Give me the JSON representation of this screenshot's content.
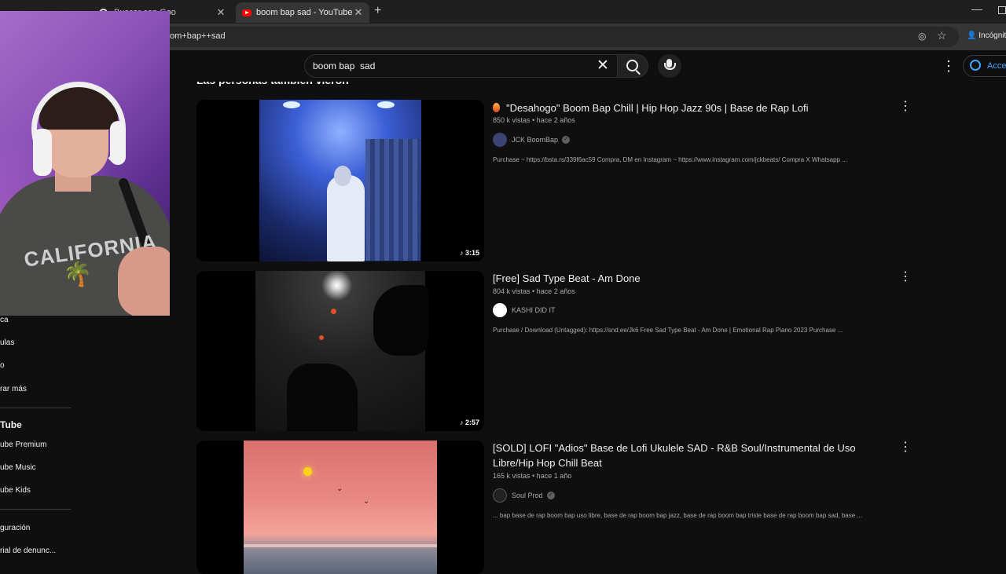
{
  "browser": {
    "tabs": [
      {
        "title": "Buscar con Goo",
        "active": false
      },
      {
        "title": "boom bap sad - YouTube",
        "active": true
      }
    ],
    "url": "om+bap++sad",
    "profile_label": "Incógnit"
  },
  "header": {
    "search_value": "boom bap  sad",
    "signin_label": "Acce"
  },
  "section_title": "Las personas también vieron",
  "results": [
    {
      "title": "\"Desahogo\" Boom Bap Chill | Hip Hop Jazz 90s | Base de Rap Lofi",
      "meta": "850 k vistas • hace 2 años",
      "channel": "JCK BoomBap",
      "verified": true,
      "description": "Purchase ~ https://bsta.rs/339f6ac59 Compra, DM en Instagram ~ https://www.instagram.com/jckbeats/ Compra X Whatsapp ...",
      "duration": "3:15"
    },
    {
      "title": "[Free] Sad Type Beat - Am Done",
      "meta": "804 k vistas • hace 2 años",
      "channel": "KASHI DID IT",
      "verified": false,
      "description": "Purchase / Download (Untagged): https://snd.ee/Jk6 Free Sad Type Beat - Am Done | Emotional Rap Piano 2023 Purchase ...",
      "duration": "2:57"
    },
    {
      "title": "[SOLD] LOFI \"Adios\" Base de Lofi Ukulele SAD - R&B Soul/Instrumental de Uso Libre/Hip Hop Chill Beat",
      "meta": "165 k vistas • hace 1 año",
      "channel": "Soul Prod",
      "verified": true,
      "description": "... bap base de rap boom bap uso libre, base de rap boom bap jazz, base de rap boom bap triste base de rap boom bap sad, base ...",
      "duration": ""
    }
  ],
  "sidebar": {
    "items_top": [
      "ca",
      "ulas",
      "o",
      "rar más"
    ],
    "heading": "Tube",
    "items_mid": [
      "ube Premium",
      "ube Music",
      "ube Kids"
    ],
    "items_bottom": [
      "guración",
      "rial de denunc..."
    ]
  },
  "colors": {
    "background": "#0f0f0f",
    "accent_blue": "#3ea6ff",
    "youtube_red": "#ff0000"
  }
}
